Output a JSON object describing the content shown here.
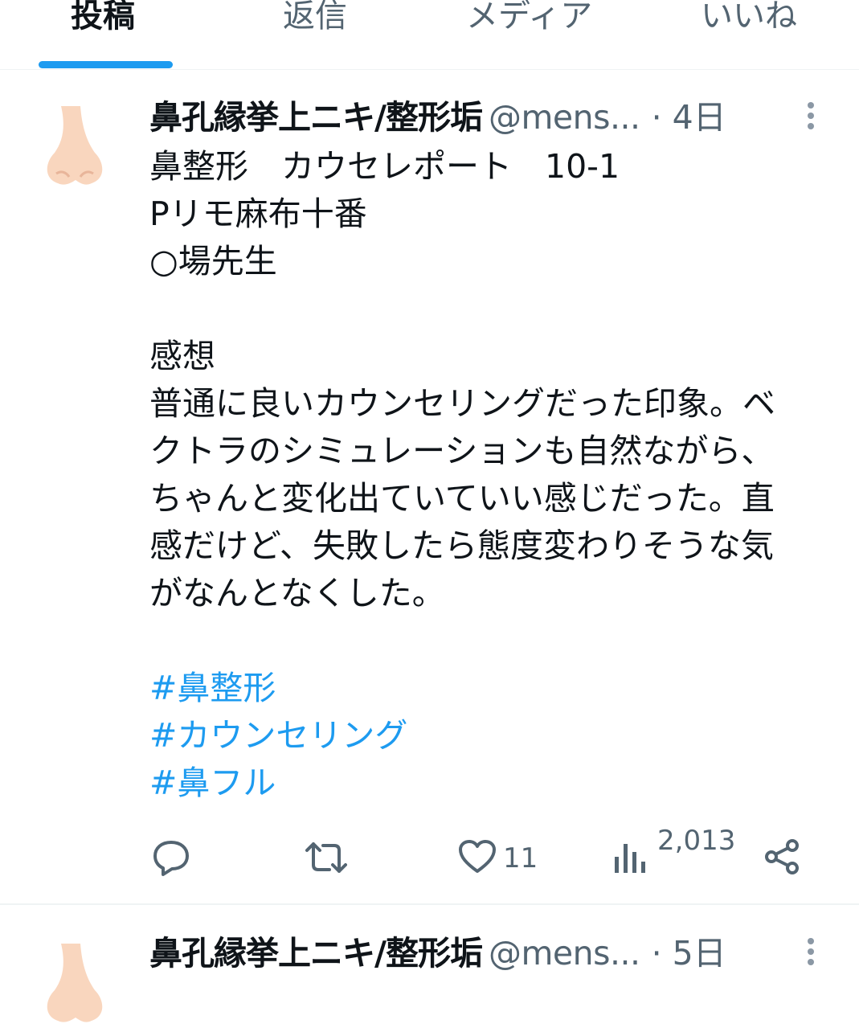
{
  "tabs": [
    {
      "label": "投稿",
      "active": true
    },
    {
      "label": "返信",
      "active": false
    },
    {
      "label": "メディア",
      "active": false
    },
    {
      "label": "いいね",
      "active": false
    }
  ],
  "colors": {
    "accent": "#1d9bf0",
    "text": "#0f1419",
    "muted": "#536471"
  },
  "posts": [
    {
      "avatar_icon": "nose-icon",
      "display_name": "鼻孔縁挙上ニキ/整形垢",
      "handle": "@mens...",
      "time": "· 4日",
      "text_lines": [
        "鼻整形　カウセレポート　10-1",
        "Pリモ麻布十番",
        "○場先生",
        "",
        "感想",
        "普通に良いカウンセリングだった印象。ベ",
        "クトラのシミュレーションも自然ながら、",
        "ちゃんと変化出ていていい感じだった。直",
        "感だけど、失敗したら態度変わりそうな気",
        "がなんとなくした。",
        ""
      ],
      "hashtags": [
        "#鼻整形",
        "#カウンセリング",
        "#鼻フル"
      ],
      "actions": {
        "reply_icon": "reply-icon",
        "repost_icon": "repost-icon",
        "like_icon": "heart-icon",
        "like_count": "11",
        "views_icon": "views-icon",
        "views_count": "2,013",
        "share_icon": "share-icon"
      }
    },
    {
      "avatar_icon": "nose-icon",
      "display_name": "鼻孔縁挙上ニキ/整形垢",
      "handle": "@mens...",
      "time": "· 5日"
    }
  ]
}
